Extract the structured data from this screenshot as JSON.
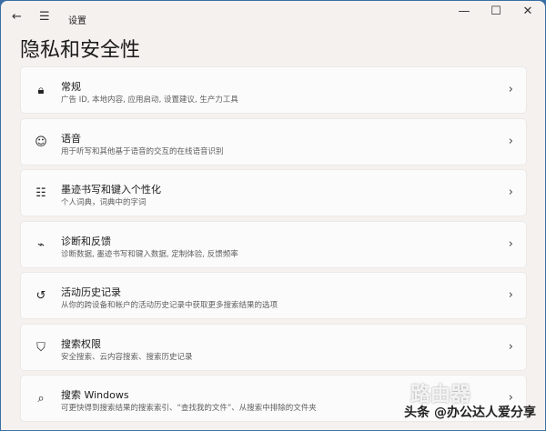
{
  "window": {
    "app_title": "设置",
    "back": "←",
    "menu": "☰",
    "minimize": "—",
    "maximize": "☐",
    "close": "✕"
  },
  "page_title": "隐私和安全性",
  "items": [
    {
      "title": "常规",
      "subtitle": "广告 ID, 本地内容, 应用启动, 设置建议, 生产力工具",
      "icon": "lock-icon",
      "glyph": "🔒︎"
    },
    {
      "title": "语音",
      "subtitle": "用于听写和其他基于语音的交互的在线语音识别",
      "icon": "speech-icon",
      "glyph": "☺"
    },
    {
      "title": "墨迹书写和键入个性化",
      "subtitle": "个人词典，词典中的字词",
      "icon": "dictionary-icon",
      "glyph": "☷"
    },
    {
      "title": "诊断和反馈",
      "subtitle": "诊断数据, 墨迹书写和键入数据, 定制体验, 反馈频率",
      "icon": "diagnostics-icon",
      "glyph": "⌁"
    },
    {
      "title": "活动历史记录",
      "subtitle": "从你的跨设备和帐户的活动历史记录中获取更多搜索结果的选项",
      "icon": "history-icon",
      "glyph": "↺"
    },
    {
      "title": "搜索权限",
      "subtitle": "安全搜索、云内容搜索、搜索历史记录",
      "icon": "search-permissions-icon",
      "glyph": "⛉"
    },
    {
      "title": "搜索 Windows",
      "subtitle": "可更快得到搜索结果的搜索索引、“查找我的文件”、从搜索中排除的文件夹",
      "icon": "search-windows-icon",
      "glyph": "⌕"
    }
  ],
  "chevron": "›",
  "watermark": "头条 @办公达人爱分享",
  "logo_text": "路由器"
}
